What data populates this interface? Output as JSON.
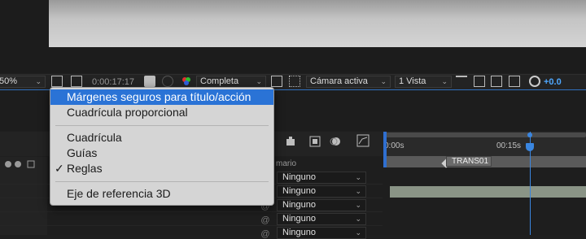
{
  "toolbar": {
    "zoom_partial": "50%",
    "timecode": "0:00:17:17",
    "resolution": "Completa",
    "camera": "Cámara activa",
    "views": "1 Vista",
    "exposure": "+0.0"
  },
  "menu": {
    "items": [
      {
        "label": "Márgenes seguros para título/acción",
        "selected": true,
        "checked": false
      },
      {
        "label": "Cuadrícula proporcional",
        "selected": false,
        "checked": false
      },
      {
        "label": "Cuadrícula",
        "selected": false,
        "checked": false
      },
      {
        "label": "Guías",
        "selected": false,
        "checked": false
      },
      {
        "label": "Reglas",
        "selected": false,
        "checked": true
      },
      {
        "label": "Eje de referencia 3D",
        "selected": false,
        "checked": false
      }
    ],
    "check_glyph": "✓"
  },
  "timeline": {
    "column_header_partial": "mario",
    "ruler": {
      "start": "0:00s",
      "mark": "00:15s"
    },
    "clip_label": "TRANS01",
    "parent_values": [
      "Ninguno",
      "Ninguno",
      "Ninguno",
      "Ninguno",
      "Ninguno"
    ]
  },
  "colors": {
    "accent": "#2a73d6",
    "cti": "#3a86e0",
    "exposure": "#4fa8ff"
  }
}
